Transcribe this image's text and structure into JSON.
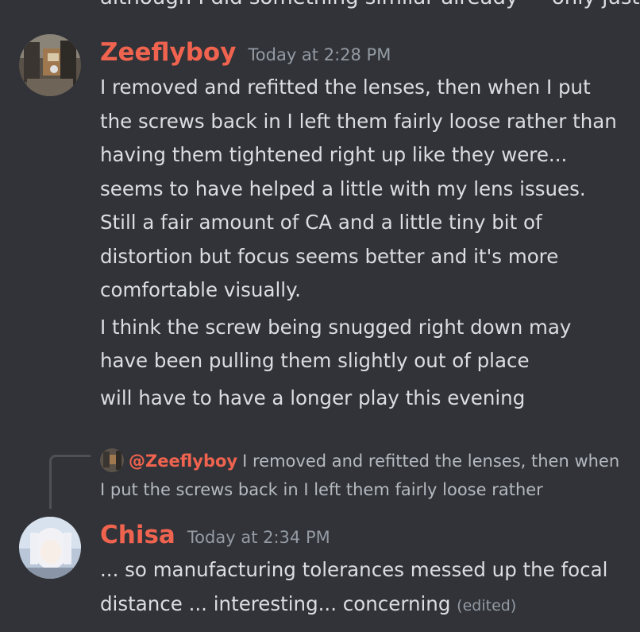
{
  "top_cut_text": "although I did something similar already — only just",
  "messages": [
    {
      "username": "Zeeflyboy",
      "timestamp": "Today at 2:28 PM",
      "paragraphs": [
        "I removed and refitted the lenses, then when I put the screws back in I left them fairly loose rather than having them tightened right up like they were... seems to have helped a little with my lens issues. Still a fair amount of CA and a little tiny bit of distortion but focus seems better and it's more comfortable visually.",
        "I think the screw being snugged right down may have been pulling them slightly out of place",
        "will have to have a longer play this evening"
      ]
    },
    {
      "reply": {
        "mention": "@Zeeflyboy",
        "excerpt": "I removed and refitted the lenses, then when I put the screws back in I left them fairly loose rather"
      },
      "username": "Chisa",
      "timestamp": "Today at 2:34 PM",
      "text": "... so manufacturing tolerances messed up the focal distance ... interesting... concerning",
      "edited_label": "(edited)"
    }
  ],
  "colors": {
    "background": "#313338",
    "username": "#f0634f",
    "text": "#dbdee1",
    "muted": "#949ba4"
  },
  "icons": {
    "zeeflyboy_avatar": "workshop-photo-avatar",
    "chisa_avatar": "anime-character-avatar"
  }
}
